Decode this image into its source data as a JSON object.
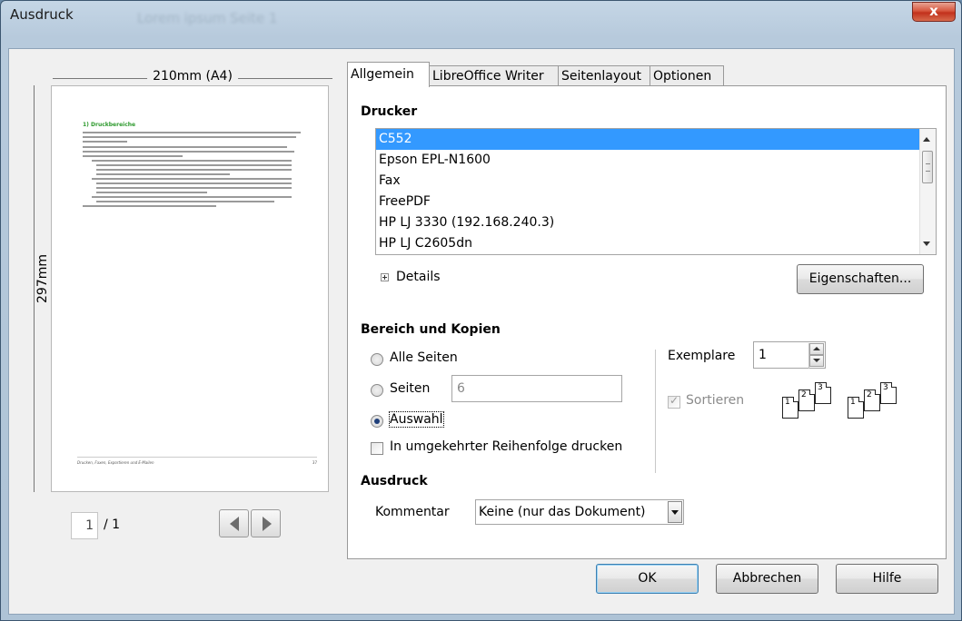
{
  "window": {
    "title": "Ausdruck",
    "ghost_title": "Lorem ipsum Seite 1",
    "close_glyph": "x"
  },
  "preview": {
    "width_label": "210mm (A4)",
    "height_label": "297mm",
    "doc_heading": "1) Druckbereiche",
    "footer_left": "Drucken, Faxen, Exportieren und E-Mailen",
    "footer_right": "37",
    "page_current": "1",
    "page_total": "/ 1"
  },
  "tabs": [
    {
      "label": "Allgemein"
    },
    {
      "label": "LibreOffice Writer"
    },
    {
      "label": "Seitenlayout"
    },
    {
      "label": "Optionen"
    }
  ],
  "printer": {
    "section_label": "Drucker",
    "items": [
      "C552",
      "Epson EPL-N1600",
      "Fax",
      "FreePDF",
      "HP LJ 3330 (192.168.240.3)",
      "HP LJ C2605dn"
    ],
    "selected": "C552",
    "details_label": "Details",
    "properties_label": "Eigenschaften..."
  },
  "range": {
    "section_label": "Bereich und Kopien",
    "all_pages_label": "Alle Seiten",
    "pages_label": "Seiten",
    "pages_value": "6",
    "selection_label": "Auswahl",
    "selected_option": "Auswahl",
    "reverse_label": "In umgekehrter Reihenfolge drucken",
    "reverse_checked": false,
    "copies_label": "Exemplare",
    "copies_value": "1",
    "collate_label": "Sortieren",
    "collate_checked": true,
    "collate_icon": "collate-pages-icon",
    "sheet_numbers": [
      "1",
      "2",
      "3"
    ]
  },
  "output": {
    "section_label": "Ausdruck",
    "comment_label": "Kommentar",
    "comment_value": "Keine (nur das Dokument)"
  },
  "buttons": {
    "ok": "OK",
    "cancel": "Abbrechen",
    "help": "Hilfe"
  },
  "colors": {
    "selection": "#3399ff",
    "title_bar": "#b7cadc",
    "close_button": "#c2311c"
  }
}
